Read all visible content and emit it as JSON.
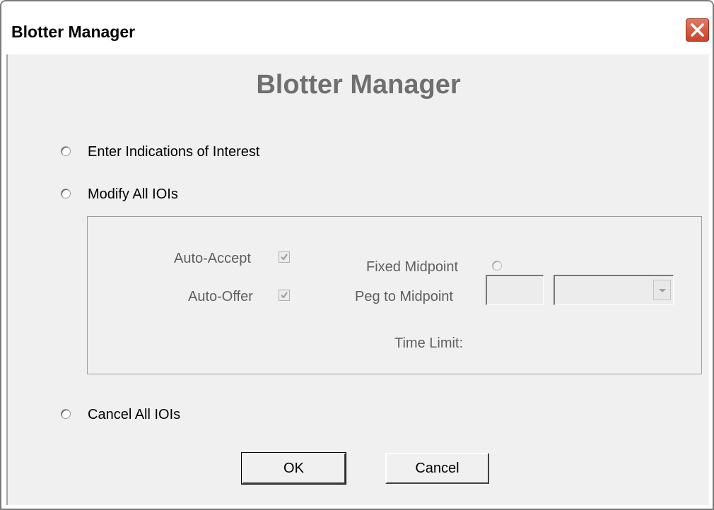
{
  "window": {
    "title": "Blotter Manager",
    "close_icon": "close-icon",
    "close_color": "#c9432a"
  },
  "heading": "Blotter Manager",
  "options": {
    "enter_ioi": {
      "label": "Enter Indications of Interest",
      "selected": false
    },
    "modify_all": {
      "label": "Modify All IOIs",
      "selected": false
    },
    "cancel_all": {
      "label": "Cancel All IOIs",
      "selected": false
    }
  },
  "modify_group": {
    "auto_accept": {
      "label": "Auto-Accept",
      "checked": true,
      "enabled": false
    },
    "auto_offer": {
      "label": "Auto-Offer",
      "checked": true,
      "enabled": false
    },
    "fixed_midpoint": {
      "label": "Fixed Midpoint",
      "selected": false,
      "enabled": false
    },
    "peg_midpoint": {
      "label": "Peg to Midpoint",
      "selected": false,
      "enabled": false
    },
    "time_limit": {
      "label": "Time Limit:",
      "value": "",
      "unit": ""
    }
  },
  "buttons": {
    "ok": "OK",
    "cancel": "Cancel"
  }
}
